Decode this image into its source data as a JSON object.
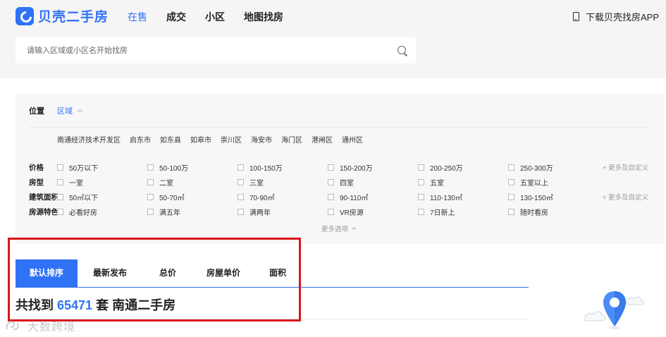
{
  "header": {
    "logo_text": "贝壳二手房",
    "nav": [
      {
        "label": "在售",
        "active": true
      },
      {
        "label": "成交",
        "active": false
      },
      {
        "label": "小区",
        "active": false
      },
      {
        "label": "地图找房",
        "active": false
      }
    ],
    "app_download": "下载贝壳找房APP",
    "search_placeholder": "请输入区域或小区名开始找房"
  },
  "filters": {
    "location_label": "位置",
    "region_toggle": "区域",
    "districts": [
      "南通经济技术开发区",
      "启东市",
      "如东县",
      "如皋市",
      "崇川区",
      "海安市",
      "海门区",
      "港闸区",
      "通州区"
    ],
    "rows": [
      {
        "label": "价格",
        "options": [
          "50万以下",
          "50-100万",
          "100-150万",
          "150-200万",
          "200-250万",
          "250-300万"
        ],
        "more": "+ 更多及自定义"
      },
      {
        "label": "房型",
        "options": [
          "一室",
          "二室",
          "三室",
          "四室",
          "五室",
          "五室以上"
        ],
        "more": ""
      },
      {
        "label": "建筑面积",
        "options": [
          "50㎡以下",
          "50-70㎡",
          "70-90㎡",
          "90-110㎡",
          "110-130㎡",
          "130-150㎡"
        ],
        "more": "+ 更多及自定义"
      },
      {
        "label": "房源特色",
        "options": [
          "必看好房",
          "满五年",
          "满两年",
          "VR房源",
          "7日新上",
          "随时看房"
        ],
        "more": ""
      }
    ],
    "more_options": "更多选项"
  },
  "sort": {
    "tabs": [
      "默认排序",
      "最新发布",
      "总价",
      "房屋单价",
      "面积"
    ],
    "active_index": 0
  },
  "results": {
    "prefix": "共找到",
    "count": "65471",
    "suffix": "套 南通二手房"
  },
  "watermark": "大数跨境",
  "colors": {
    "brand_blue": "#3072f6",
    "highlight_red": "#d9151c"
  }
}
